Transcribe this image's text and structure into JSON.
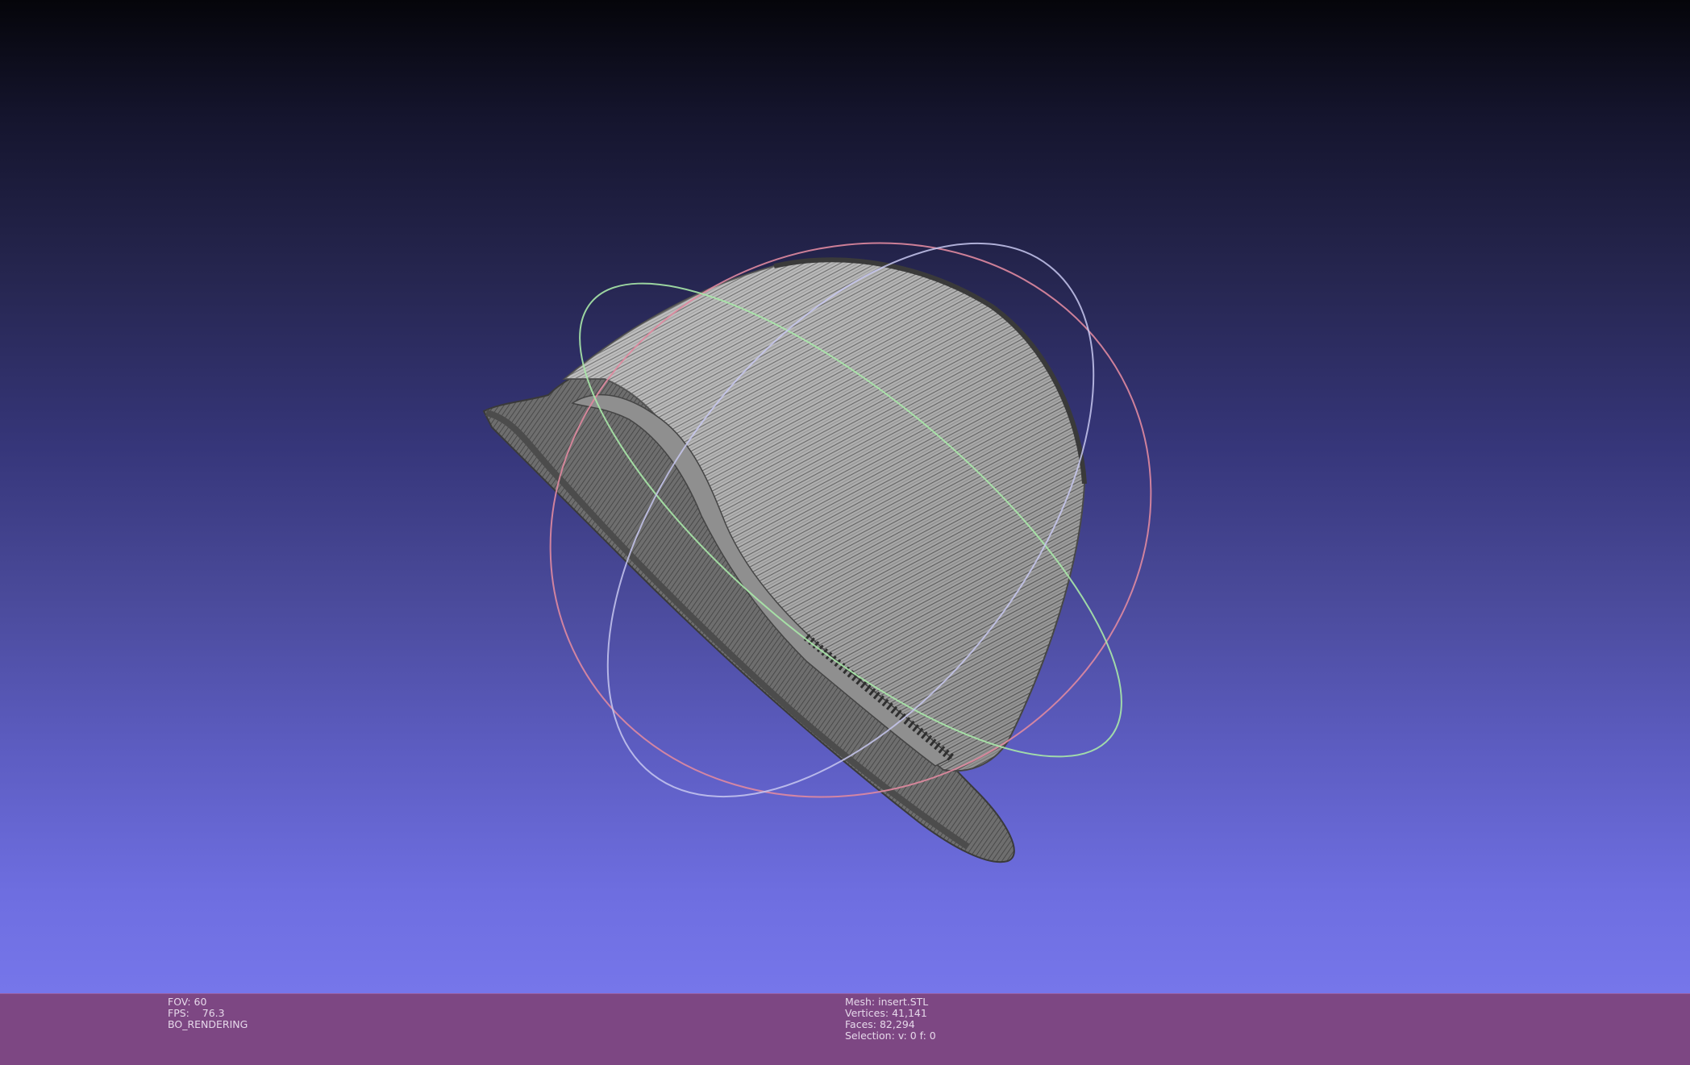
{
  "viewer": {
    "model_name": "insert.STL",
    "colors": {
      "background_top": "#05050a",
      "background_bottom": "#7676ea",
      "status_bar": "#7d4783",
      "mesh_wire": "#5a5a5a",
      "mesh_light": "#bdbdbd",
      "trackball_x": "#e08aa0",
      "trackball_y": "#a8e8a8",
      "trackball_z": "#c8c8f0"
    }
  },
  "status_left": {
    "fov_label": "FOV:",
    "fov_value": "60",
    "fps_label": "FPS:",
    "fps_value": "76.3",
    "mode": "BO_RENDERING"
  },
  "status_center": {
    "mesh_label": "Mesh:",
    "mesh_value": "insert.STL",
    "vertices_label": "Vertices:",
    "vertices_value": "41,141",
    "faces_label": "Faces:",
    "faces_value": "82,294",
    "selection_label": "Selection:",
    "selection_value": "v: 0 f: 0"
  }
}
